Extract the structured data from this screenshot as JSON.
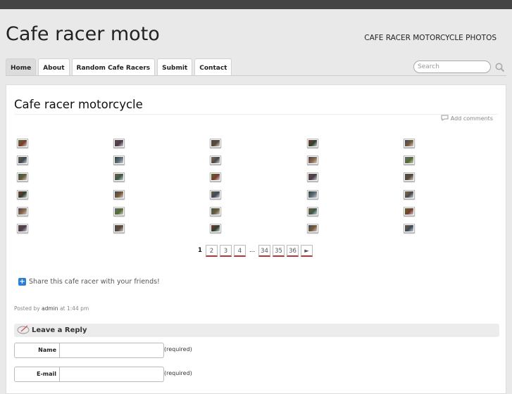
{
  "header": {
    "site_title": "Cafe racer moto",
    "site_description": "CAFE RACER MOTORCYCLE PHOTOS"
  },
  "nav": {
    "items": [
      {
        "label": "Home",
        "active": true
      },
      {
        "label": "About"
      },
      {
        "label": "Random Cafe Racers"
      },
      {
        "label": "Submit"
      },
      {
        "label": "Contact"
      }
    ]
  },
  "search": {
    "placeholder": "Search",
    "icon": "search-icon"
  },
  "post": {
    "title": "Cafe racer motorcycle",
    "add_comments": "Add comments",
    "add_comments_icon": "comment-icon",
    "thumbnail_rows": 6,
    "thumbnail_cols": 5,
    "thumbnail_colors": [
      "#556b2f",
      "#5a4a3a",
      "#4a4a4a",
      "#7a3b2e",
      "#3d4a5a",
      "#6b5b3a",
      "#2f3f2f",
      "#8a6a4a",
      "#4d3d4d",
      "#5e6e7e",
      "#3a5a4a",
      "#7a5a3a"
    ]
  },
  "pagination": {
    "current": "1",
    "pages": [
      "2",
      "3",
      "4"
    ],
    "ellipsis": "...",
    "last_pages": [
      "34",
      "35",
      "36"
    ],
    "next": "►"
  },
  "share": {
    "icon": "plus-icon",
    "text": "Share this cafe racer with your friends!"
  },
  "meta": {
    "posted_by": "Posted by",
    "author": "admin",
    "at": "at",
    "time": "1:44 pm"
  },
  "reply": {
    "title": "Leave a Reply",
    "icon": "pencil-icon",
    "fields": [
      {
        "label": "Name",
        "note": "(required)"
      },
      {
        "label": "E-mail",
        "note": "(required)"
      }
    ]
  }
}
